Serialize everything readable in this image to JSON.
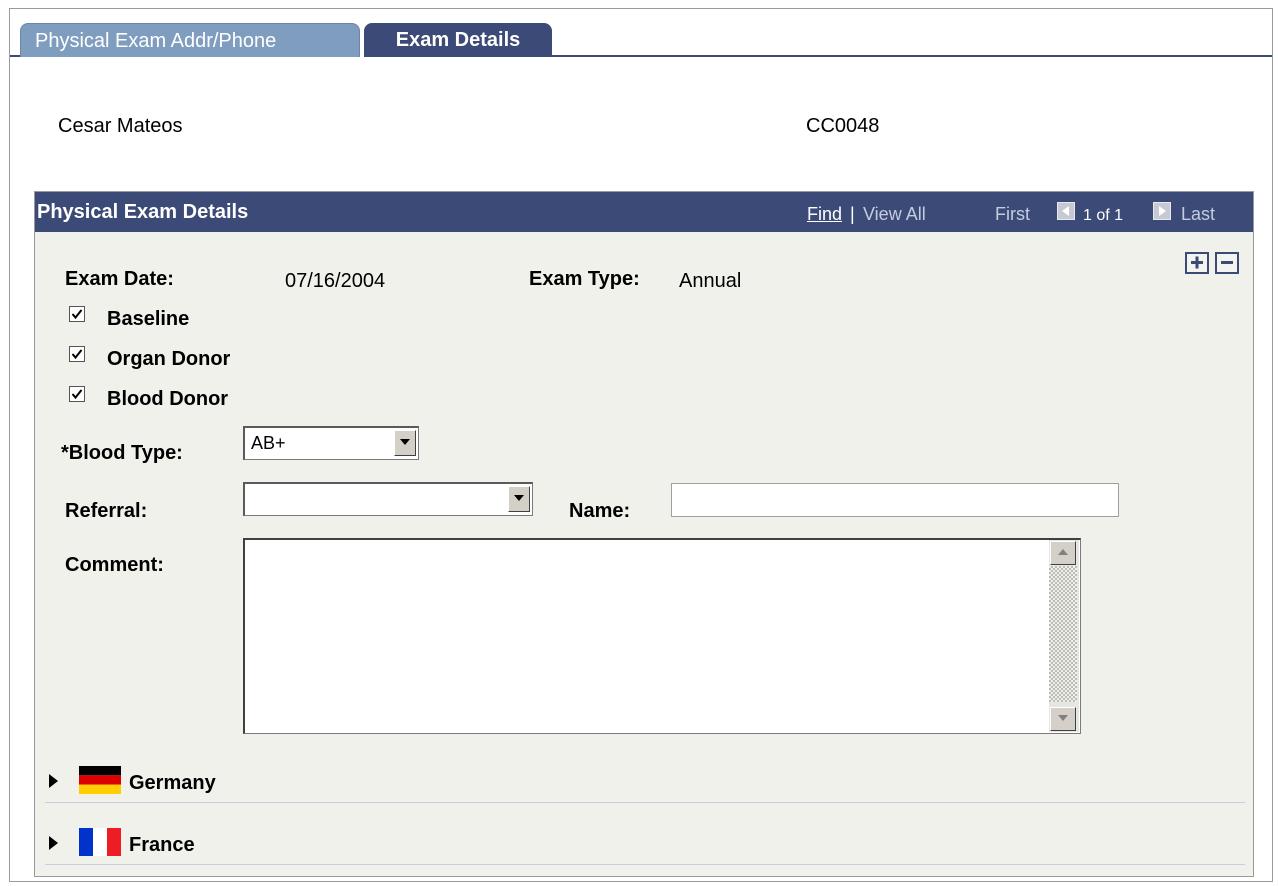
{
  "tabs": [
    {
      "label": "Physical Exam Addr/Phone",
      "active": false
    },
    {
      "label": "Exam Details",
      "active": true
    }
  ],
  "employee": {
    "name": "Cesar Mateos",
    "id": "CC0048"
  },
  "group": {
    "title": "Physical Exam Details",
    "nav": {
      "find": "Find",
      "separator": "|",
      "view_all": "View All",
      "first": "First",
      "count": "1 of 1",
      "last": "Last"
    }
  },
  "fields": {
    "exam_date_label": "Exam Date:",
    "exam_date_value": "07/16/2004",
    "exam_type_label": "Exam Type:",
    "exam_type_value": "Annual",
    "baseline_label": "Baseline",
    "baseline_checked": true,
    "organ_donor_label": "Organ Donor",
    "organ_donor_checked": true,
    "blood_donor_label": "Blood Donor",
    "blood_donor_checked": true,
    "blood_type_label": "*Blood Type:",
    "blood_type_value": "AB+",
    "referral_label": "Referral:",
    "referral_value": "",
    "name_label": "Name:",
    "name_value": "",
    "comment_label": "Comment:",
    "comment_value": ""
  },
  "sections": [
    {
      "label": "Germany",
      "flag": "germany-flag-icon",
      "expanded": false
    },
    {
      "label": "France",
      "flag": "france-flag-icon",
      "expanded": false
    }
  ],
  "colors": {
    "header_bg": "#3b4a76",
    "inactive_tab": "#7f9dbe",
    "panel_bg": "#f1f1ec"
  }
}
